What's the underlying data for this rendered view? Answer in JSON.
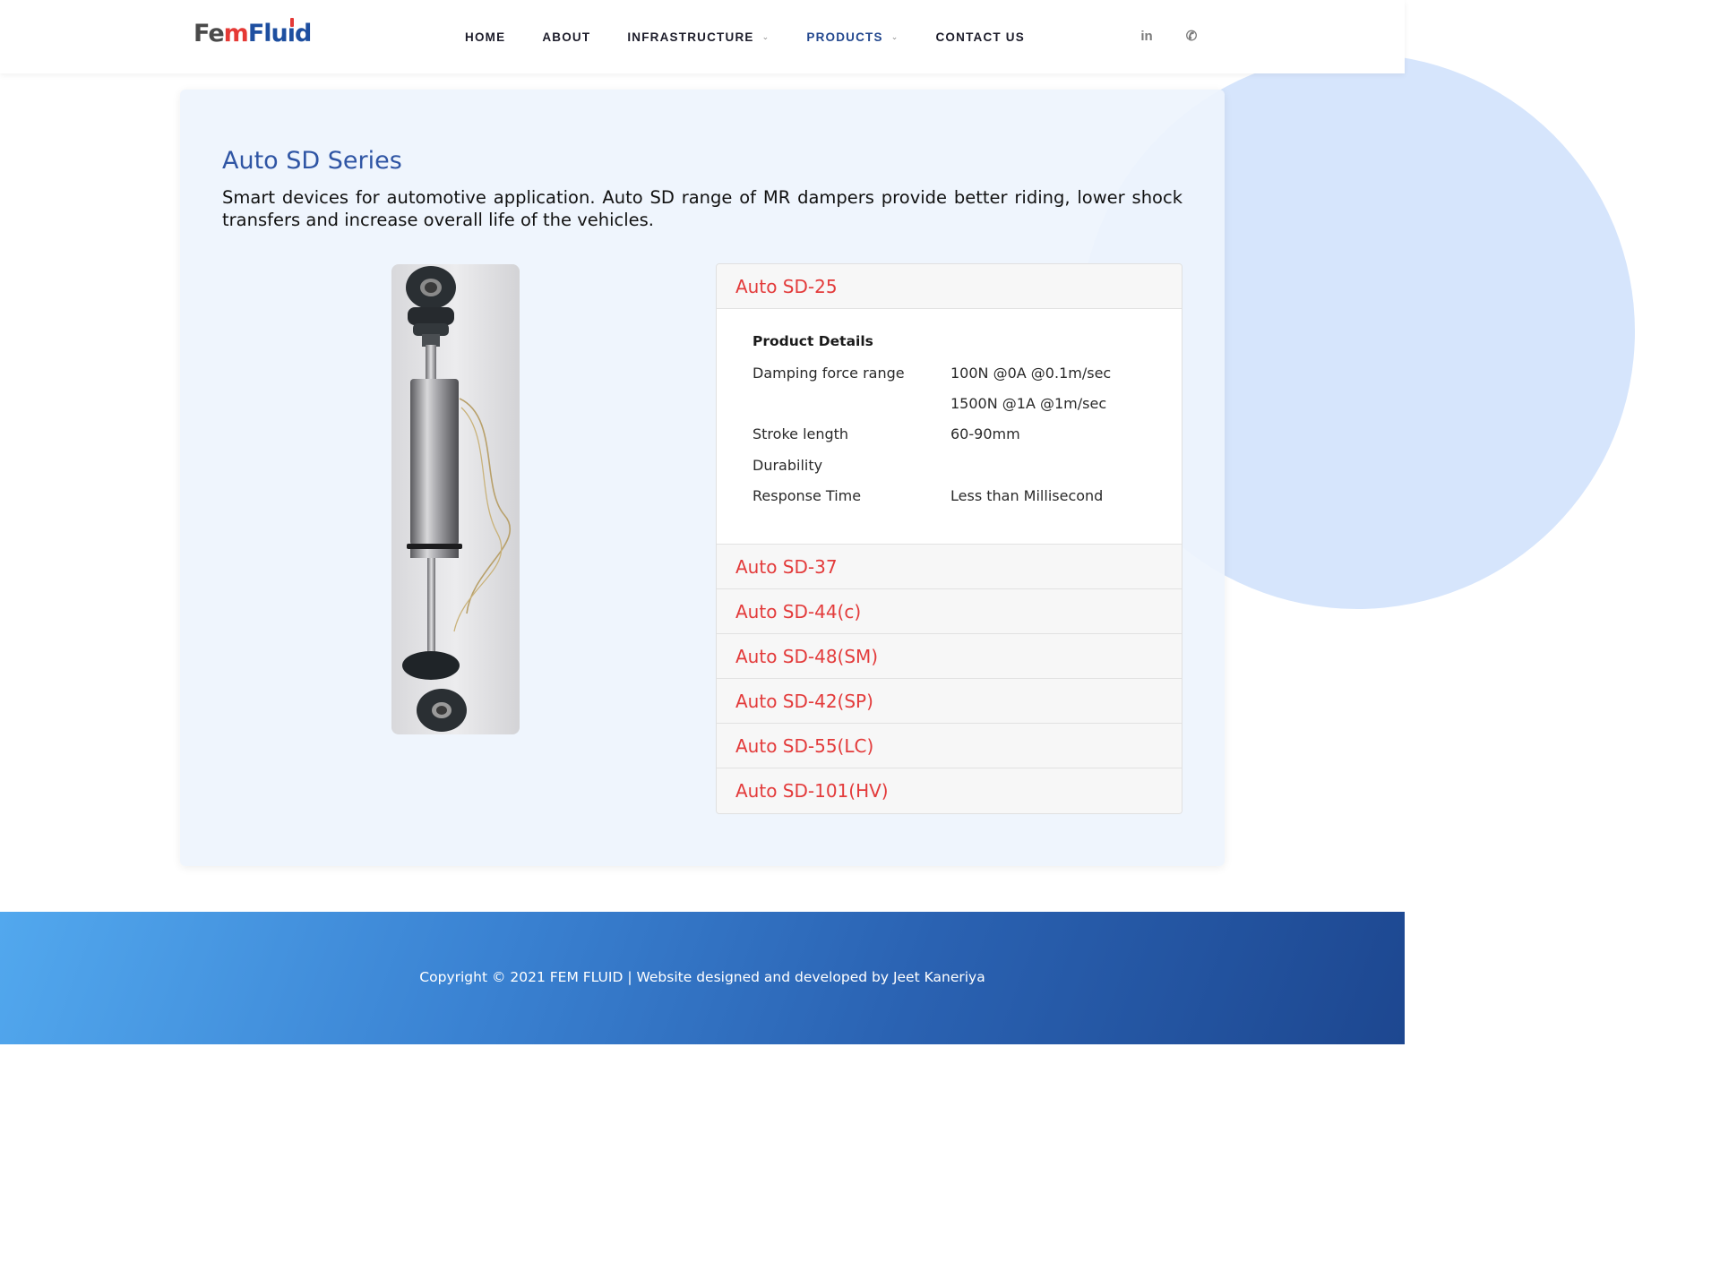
{
  "header": {
    "logo": {
      "part1": "Fe",
      "part2": "m",
      "part3": "Flu",
      "part4": "ı",
      "part5": "d"
    },
    "nav": [
      {
        "label": "HOME"
      },
      {
        "label": "ABOUT"
      },
      {
        "label": "INFRASTRUCTURE",
        "caret": "⌄"
      },
      {
        "label": "PRODUCTS",
        "caret": "⌄"
      },
      {
        "label": "CONTACT US"
      }
    ],
    "icons": {
      "linkedin": "in",
      "phone": "✆"
    }
  },
  "main": {
    "title": "Auto SD Series",
    "description": "Smart devices for automotive application. Auto SD range of MR dampers provide better riding, lower shock transfers and increase overall life of the vehicles.",
    "accordion": {
      "open_item": "Auto SD-25",
      "details_title": "Product Details",
      "details": [
        {
          "label": "Damping force range",
          "value": "100N @0A @0.1m/sec"
        },
        {
          "label": "",
          "value": "1500N @1A @1m/sec"
        },
        {
          "label": "Stroke length",
          "value": "60-90mm"
        },
        {
          "label": "Durability",
          "value": ""
        },
        {
          "label": "Response Time",
          "value": "Less than Millisecond"
        }
      ],
      "collapsed_items": [
        "Auto SD-37",
        "Auto SD-44(c)",
        "Auto SD-48(SM)",
        "Auto SD-42(SP)",
        "Auto SD-55(LC)",
        "Auto SD-101(HV)"
      ]
    }
  },
  "footer": {
    "copyright": "Copyright © 2021 FEM FLUID | Website designed and developed by Jeet Kaneriya"
  },
  "colors": {
    "accent": "#2f55a4",
    "accordion_title": "#e33b3b",
    "nav_active": "#23488f"
  }
}
